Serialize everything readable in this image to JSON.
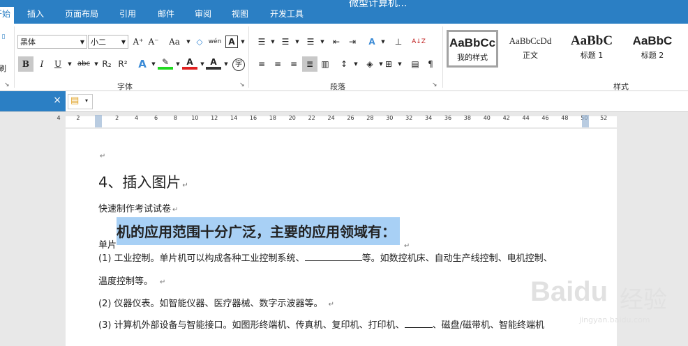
{
  "window": {
    "title": "微型计算机... "
  },
  "tabs": [
    {
      "label": "开始"
    },
    {
      "label": "插入"
    },
    {
      "label": "页面布局"
    },
    {
      "label": "引用"
    },
    {
      "label": "邮件"
    },
    {
      "label": "审阅"
    },
    {
      "label": "视图"
    },
    {
      "label": "开发工具"
    }
  ],
  "clipboard": {
    "format_painter_label": "刷"
  },
  "font": {
    "name": "黑体",
    "size": "小二",
    "group_label": "字体",
    "grow_glyph": "A⁺",
    "shrink_glyph": "A⁻",
    "case_glyph": "Aa",
    "phonetic_glyph": "wén",
    "border_glyph": "A",
    "bold_glyph": "B",
    "italic_glyph": "I",
    "underline_glyph": "U",
    "strike_glyph": "abc",
    "subscript_glyph": "R₂",
    "superscript_glyph": "R²",
    "effect_glyph": "A",
    "highlight_glyph": "✎",
    "color_glyph": "A",
    "shade_glyph": "A",
    "enclose_glyph": "字"
  },
  "paragraph": {
    "group_label": "段落",
    "sort_glyph": "A↓Z",
    "show_marks_glyph": "¶"
  },
  "styles": {
    "group_label": "样式",
    "items": [
      {
        "sample": "AaBbCc",
        "name": "我的样式"
      },
      {
        "sample": "AaBbCcDd",
        "name": "正文"
      },
      {
        "sample": "AaBbC",
        "name": "标题 1"
      },
      {
        "sample": "AaBbC",
        "name": "标题 2"
      }
    ]
  },
  "docbar": {
    "close_glyph": "×",
    "new_glyph": "▾"
  },
  "ruler": {
    "labels": [
      "4",
      "2",
      "",
      "2",
      "4",
      "6",
      "8",
      "10",
      "12",
      "14",
      "16",
      "18",
      "20",
      "22",
      "24",
      "26",
      "28",
      "30",
      "32",
      "34",
      "36",
      "38",
      "40",
      "42",
      "44",
      "46",
      "48",
      "50",
      "52"
    ]
  },
  "document": {
    "para_mark": "↵",
    "heading": "4、插入图片",
    "line_title": "快速制作考试试卷",
    "sel_prefix": "单片",
    "sel_text": "机的应用范围十分广泛，主要的应用领域有：",
    "line1_a": "(1)  工业控制。单片机可以构成各种工业控制系统、",
    "line1_b": "等。如数控机床、自动生产线控制、电机控制、",
    "line2": "温度控制等。",
    "line3": "(2)  仪器仪表。如智能仪器、医疗器械、数字示波器等。",
    "line4_a": "(3)  计算机外部设备与智能接口。如图形终端机、传真机、复印机、打印机、",
    "line4_b": "、磁盘/磁带机、智能终端机"
  },
  "watermark": {
    "brand": "Baidu",
    "brand_cn": "经验",
    "url": "jingyan.baidu.com"
  }
}
